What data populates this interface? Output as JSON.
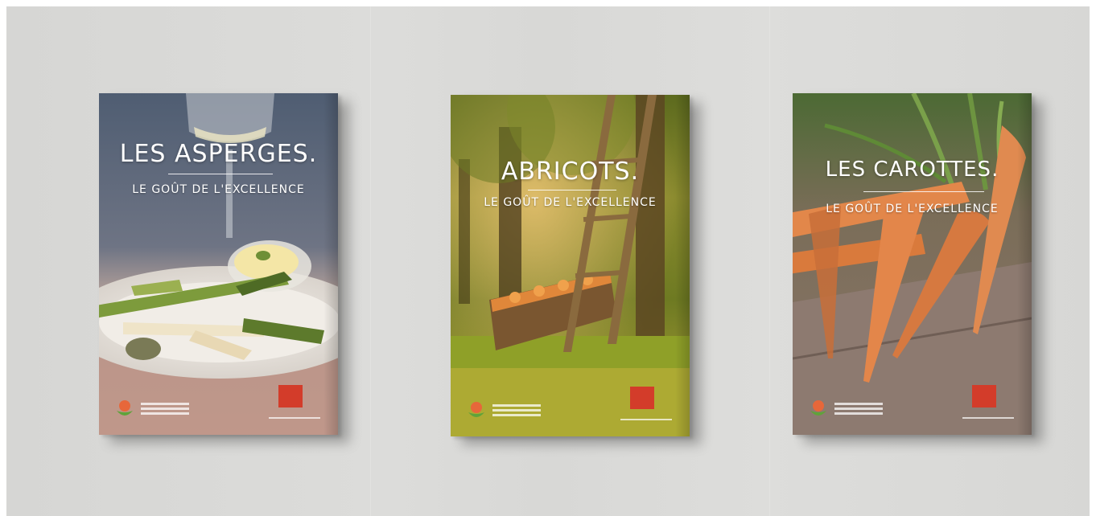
{
  "scene": {
    "wall_color": "#d9d9d7",
    "brochures": [
      {
        "title": "LES ASPERGES.",
        "tagline": "LE GOÛT DE L'EXCELLENCE",
        "palette": [
          "#5c6b7e",
          "#c9b4a8",
          "#6f8f36"
        ]
      },
      {
        "title": "ABRICOTS.",
        "tagline": "LE GOÛT DE L'EXCELLENCE",
        "palette": [
          "#6b7a1f",
          "#b46b2c",
          "#e8a14a"
        ]
      },
      {
        "title": "LES CAROTTES.",
        "tagline": "LE GOÛT DE L'EXCELLENCE",
        "palette": [
          "#4b6b2e",
          "#e07a3a",
          "#8a6e5c"
        ]
      }
    ],
    "brand_colors": {
      "valais_red": "#d33c2a",
      "leaf_green": "#5fa33a",
      "flower_orange": "#e7673a"
    },
    "logos": [
      "fruits-legumes-valais-logo",
      "valais-brand-logo"
    ]
  }
}
